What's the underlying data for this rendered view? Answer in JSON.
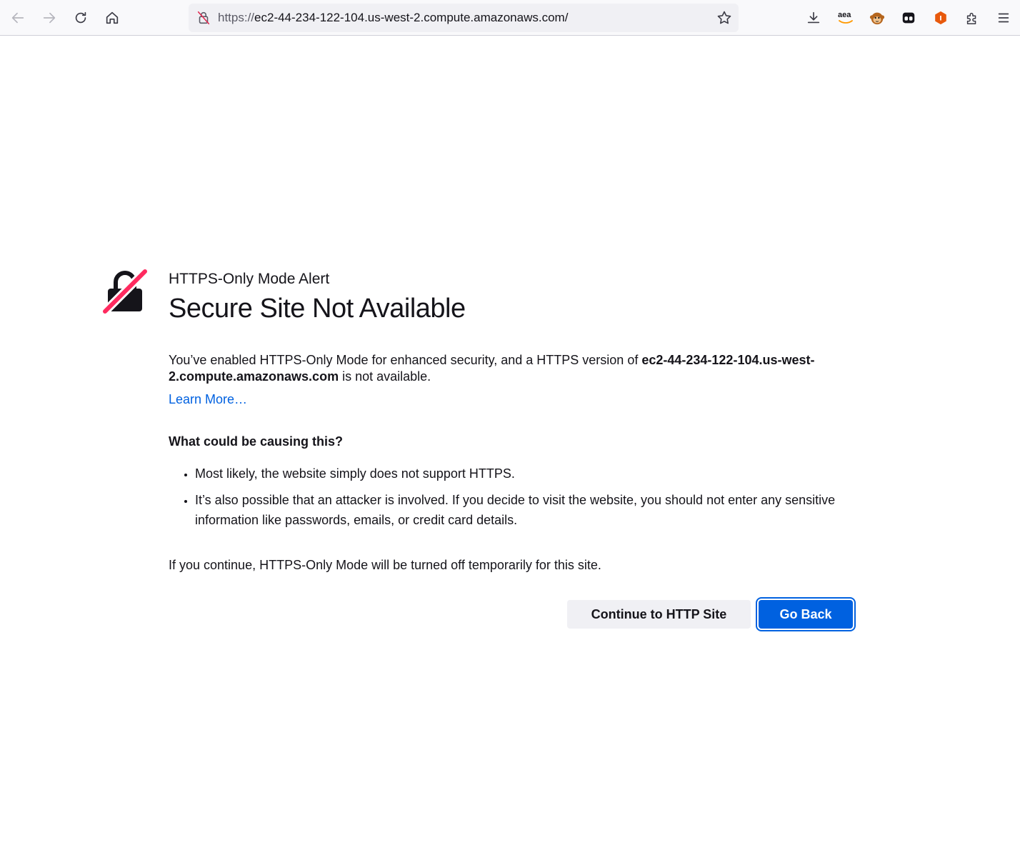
{
  "toolbar": {
    "url_protocol": "https://",
    "url_host": "ec2-44-234-122-104.us-west-2.compute.amazonaws.com/",
    "extensions": [
      {
        "name": "amazon-assistant-icon",
        "label": "aea"
      },
      {
        "name": "monkey-extension-icon"
      },
      {
        "name": "tab-extension-icon"
      },
      {
        "name": "honey-extension-icon",
        "label": "I"
      }
    ]
  },
  "page": {
    "subtitle": "HTTPS-Only Mode Alert",
    "title": "Secure Site Not Available",
    "desc_prefix": "You’ve enabled HTTPS-Only Mode for enhanced security, and a HTTPS version of ",
    "desc_host": "ec2-44-234-122-104.us-west-2.compute.amazonaws.com",
    "desc_suffix": " is not available.",
    "learn_more": "Learn More…",
    "question": "What could be causing this?",
    "reasons": [
      "Most likely, the website simply does not support HTTPS.",
      "It’s also possible that an attacker is involved. If you decide to visit the website, you should not enter any sensitive information like passwords, emails, or credit card details."
    ],
    "note": "If you continue, HTTPS-Only Mode will be turned off temporarily for this site.",
    "continue_button": "Continue to HTTP Site",
    "go_back_button": "Go Back"
  },
  "colors": {
    "accent": "#0061e0",
    "strike": "#ff2a5f"
  }
}
